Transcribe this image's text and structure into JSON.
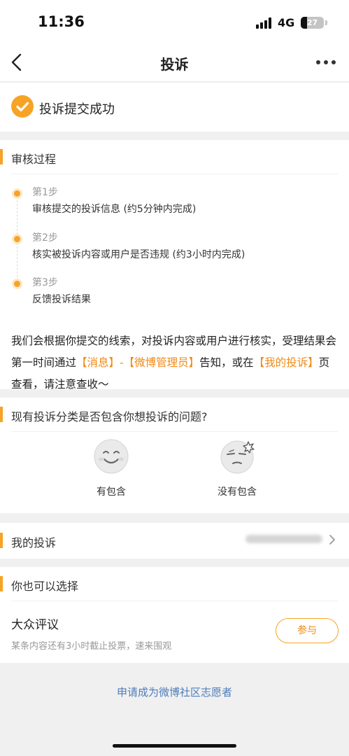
{
  "status_bar": {
    "time": "11:36",
    "network": "4G",
    "battery": "27"
  },
  "nav": {
    "title": "投诉",
    "back_icon": "chevron-left-icon",
    "more_icon": "more-horizontal-icon"
  },
  "success": {
    "icon": "check-circle-icon",
    "text": "投诉提交成功"
  },
  "review": {
    "title": "审核过程",
    "steps": [
      {
        "label": "第1步",
        "desc": "审核提交的投诉信息 (约5分钟内完成)"
      },
      {
        "label": "第2步",
        "desc": "核实被投诉内容或用户是否违规 (约3小时内完成)"
      },
      {
        "label": "第3步",
        "desc": "反馈投诉结果"
      }
    ],
    "notice": {
      "part1": "我们会根据你提交的线索，对投诉内容或用户进行核实，受理结果会第一时间通过",
      "link1": "【消息】-【微博管理员】",
      "part2": "告知，或在",
      "link2": "【我的投诉】",
      "part3": "页查看，请注意查收～"
    }
  },
  "survey": {
    "title": "现有投诉分类是否包含你想投诉的问题?",
    "options": [
      {
        "label": "有包含",
        "icon": "smile-face-icon"
      },
      {
        "label": "没有包含",
        "icon": "annoyed-face-icon"
      }
    ]
  },
  "my_complaints": {
    "title": "我的投诉",
    "chevron_icon": "chevron-right-icon"
  },
  "options": {
    "title": "你也可以选择",
    "item_title": "大众评议",
    "item_desc": "某条内容还有3小时截止投票，速来围观",
    "button": "参与"
  },
  "footer": {
    "volunteer_link": "申请成为微博社区志愿者"
  },
  "colors": {
    "accent": "#f7a326",
    "highlight": "#f08a16",
    "link": "#4f7dbb"
  }
}
